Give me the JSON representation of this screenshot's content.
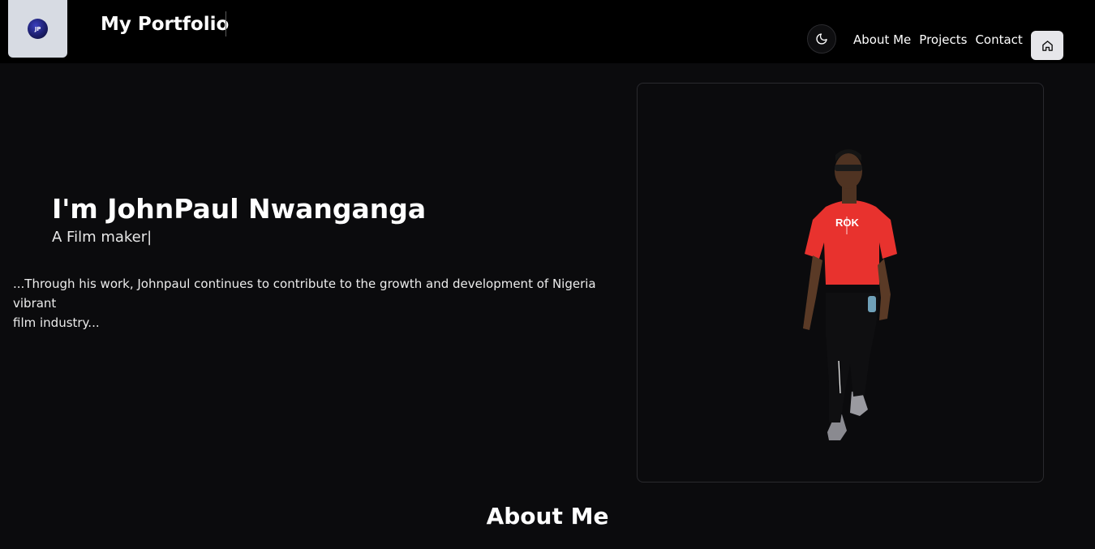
{
  "header": {
    "logo_text": "JP",
    "site_title": "My Portfolio",
    "theme_toggle_icon": "moon-icon",
    "home_icon": "home-icon",
    "nav": [
      {
        "label": "About Me"
      },
      {
        "label": "Projects"
      },
      {
        "label": "Contact"
      }
    ]
  },
  "hero": {
    "name": "I'm JohnPaul Nwanganga",
    "role": "A Film maker",
    "cursor": "|",
    "description_line1": "...Through his work, Johnpaul continues to contribute to the growth and development of Nigeria vibrant",
    "description_line2": "film industry...",
    "shirt_text": "ROK"
  },
  "sections": {
    "about_title": "About Me"
  },
  "colors": {
    "background": "#0b0b0d",
    "header": "#000000",
    "logo_box": "#d7dbe3",
    "shirt": "#e8322e",
    "text": "#ffffff"
  }
}
